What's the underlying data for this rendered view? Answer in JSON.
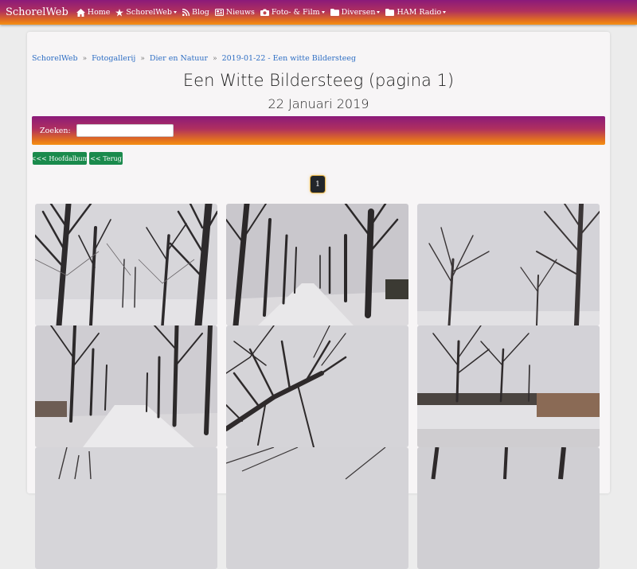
{
  "navbar": {
    "brand": "SchorelWeb",
    "items": [
      {
        "label": "Home",
        "icon": "home-icon",
        "dropdown": false
      },
      {
        "label": "SchorelWeb",
        "icon": "star-icon",
        "dropdown": true
      },
      {
        "label": "Blog",
        "icon": "rss-icon",
        "dropdown": false
      },
      {
        "label": "Nieuws",
        "icon": "newspaper-icon",
        "dropdown": false
      },
      {
        "label": "Foto- & Film",
        "icon": "camera-icon",
        "dropdown": true
      },
      {
        "label": "Diversen",
        "icon": "folder-icon",
        "dropdown": true
      },
      {
        "label": "HAM Radio",
        "icon": "folder-icon",
        "dropdown": true
      }
    ]
  },
  "breadcrumb": {
    "items": [
      "SchorelWeb",
      "Fotogallerij",
      "Dier en Natuur",
      "2019-01-22 - Een witte Bildersteeg"
    ],
    "separator": "»"
  },
  "page": {
    "title": "Een Witte Bildersteeg (pagina 1)",
    "subtitle": "22 Januari 2019"
  },
  "search": {
    "label": "Zoeken:",
    "value": "",
    "placeholder": ""
  },
  "buttons": {
    "main_album": "<<< Hoofdalbum",
    "back": "<< Terug"
  },
  "pagination": {
    "current": "1"
  },
  "colors": {
    "gradient_top": "#8b1a7a",
    "gradient_bottom": "#f59014",
    "link": "#2f6fc4",
    "button_green": "#1a8a4c"
  },
  "gallery": {
    "photos": [
      {
        "name": "photo-1"
      },
      {
        "name": "photo-2"
      },
      {
        "name": "photo-3"
      },
      {
        "name": "photo-4"
      },
      {
        "name": "photo-5"
      },
      {
        "name": "photo-6"
      },
      {
        "name": "photo-7"
      },
      {
        "name": "photo-8"
      },
      {
        "name": "photo-9"
      }
    ]
  }
}
